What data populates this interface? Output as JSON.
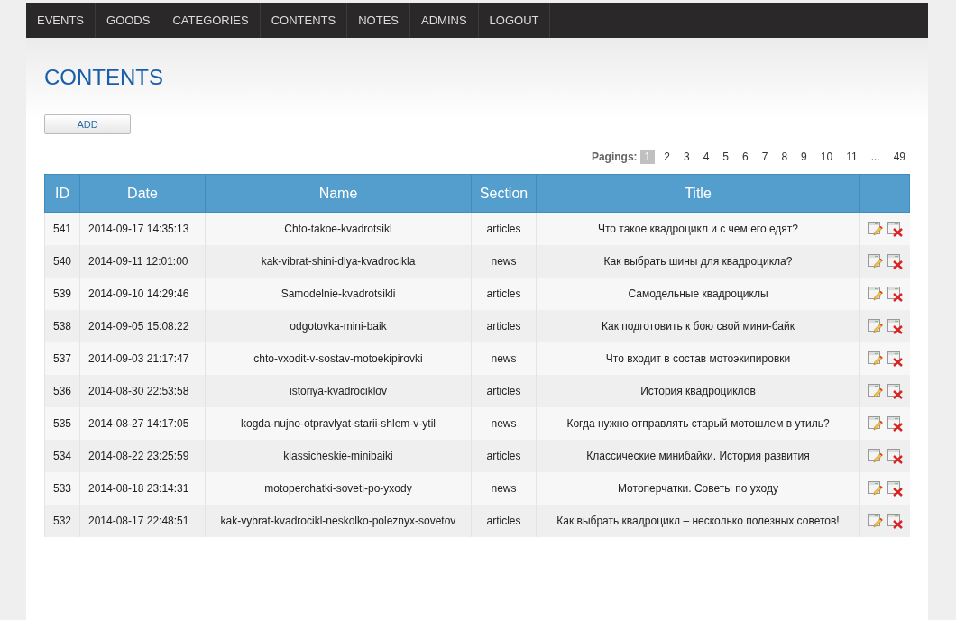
{
  "nav": [
    {
      "label": "EVENTS"
    },
    {
      "label": "GOODS"
    },
    {
      "label": "CATEGORIES"
    },
    {
      "label": "CONTENTS"
    },
    {
      "label": "NOTES"
    },
    {
      "label": "ADMINS"
    },
    {
      "label": "LOGOUT"
    }
  ],
  "page_title": "CONTENTS",
  "add_button": "ADD",
  "pagination": {
    "label": "Pagings:",
    "pages": [
      {
        "label": "1",
        "selected": true
      },
      {
        "label": "2",
        "selected": false
      },
      {
        "label": "3",
        "selected": false
      },
      {
        "label": "4",
        "selected": false
      },
      {
        "label": "5",
        "selected": false
      },
      {
        "label": "6",
        "selected": false
      },
      {
        "label": "7",
        "selected": false
      },
      {
        "label": "8",
        "selected": false
      },
      {
        "label": "9",
        "selected": false
      },
      {
        "label": "10",
        "selected": false
      },
      {
        "label": "11",
        "selected": false
      },
      {
        "label": "...",
        "selected": false
      },
      {
        "label": "49",
        "selected": false
      }
    ]
  },
  "table": {
    "columns": [
      "ID",
      "Date",
      "Name",
      "Section",
      "Title"
    ],
    "rows": [
      {
        "id": "541",
        "date": "2014-09-17 14:35:13",
        "name": "Chto-takoe-kvadrotsikl",
        "section": "articles",
        "title": "Что такое квадроцикл и с чем его едят?"
      },
      {
        "id": "540",
        "date": "2014-09-11 12:01:00",
        "name": "kak-vibrat-shini-dlya-kvadrocikla",
        "section": "news",
        "title": "Как выбрать шины для квадроцикла?"
      },
      {
        "id": "539",
        "date": "2014-09-10 14:29:46",
        "name": "Samodelnie-kvadrotsikli",
        "section": "articles",
        "title": "Самодельные квадроциклы"
      },
      {
        "id": "538",
        "date": "2014-09-05 15:08:22",
        "name": "odgotovka-mini-baik",
        "section": "articles",
        "title": "Как подготовить к бою свой мини-байк"
      },
      {
        "id": "537",
        "date": "2014-09-03 21:17:47",
        "name": "chto-vxodit-v-sostav-motoekipirovki",
        "section": "news",
        "title": "Что входит в состав мотоэкипировки"
      },
      {
        "id": "536",
        "date": "2014-08-30 22:53:58",
        "name": "istoriya-kvadrociklov",
        "section": "articles",
        "title": "История квадроциклов"
      },
      {
        "id": "535",
        "date": "2014-08-27 14:17:05",
        "name": "kogda-nujno-otpravlyat-starii-shlem-v-ytil",
        "section": "news",
        "title": "Когда нужно отправлять старый мотошлем в утиль?"
      },
      {
        "id": "534",
        "date": "2014-08-22 23:25:59",
        "name": "klassicheskie-minibaiki",
        "section": "articles",
        "title": "Классические минибайки. История развития"
      },
      {
        "id": "533",
        "date": "2014-08-18 23:14:31",
        "name": "motoperchatki-soveti-po-yxody",
        "section": "news",
        "title": "Мотоперчатки. Советы по уходу"
      },
      {
        "id": "532",
        "date": "2014-08-17 22:48:51",
        "name": "kak-vybrat-kvadrocikl-neskolko-poleznyx-sovetov",
        "section": "articles",
        "title": "Как выбрать квадроцикл – несколько полезных советов!"
      }
    ]
  }
}
